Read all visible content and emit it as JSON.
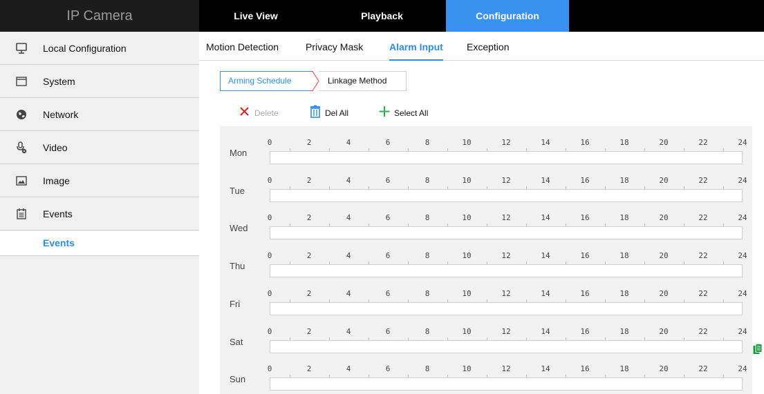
{
  "app": {
    "brand": "IP Camera"
  },
  "nav": {
    "live_view": "Live View",
    "playback": "Playback",
    "configuration": "Configuration"
  },
  "sidebar": {
    "items": [
      {
        "label": "Local Configuration",
        "icon": "monitor-icon"
      },
      {
        "label": "System",
        "icon": "window-icon"
      },
      {
        "label": "Network",
        "icon": "globe-icon"
      },
      {
        "label": "Video",
        "icon": "microphone-video-icon"
      },
      {
        "label": "Image",
        "icon": "picture-icon"
      },
      {
        "label": "Events",
        "icon": "calendar-icon"
      }
    ],
    "sub_selected": "Events"
  },
  "tabs": {
    "motion_detection": "Motion Detection",
    "privacy_mask": "Privacy Mask",
    "alarm_input": "Alarm Input",
    "exception": "Exception",
    "active": "Alarm Input"
  },
  "subtabs": {
    "arming_schedule": "Arming Schedule",
    "linkage_method": "Linkage Method",
    "active": "Arming Schedule"
  },
  "toolbar": {
    "delete": "Delete",
    "del_all": "Del All",
    "select_all": "Select All"
  },
  "schedule": {
    "days": [
      "Mon",
      "Tue",
      "Wed",
      "Thu",
      "Fri",
      "Sat",
      "Sun"
    ],
    "hours": [
      "0",
      "2",
      "4",
      "6",
      "8",
      "10",
      "12",
      "14",
      "16",
      "18",
      "20",
      "22",
      "24"
    ]
  },
  "colors": {
    "accent": "#3a92f0",
    "delete_icon": "#e02020",
    "add_icon": "#2bb34a",
    "copy_icon": "#1a9a3a"
  }
}
